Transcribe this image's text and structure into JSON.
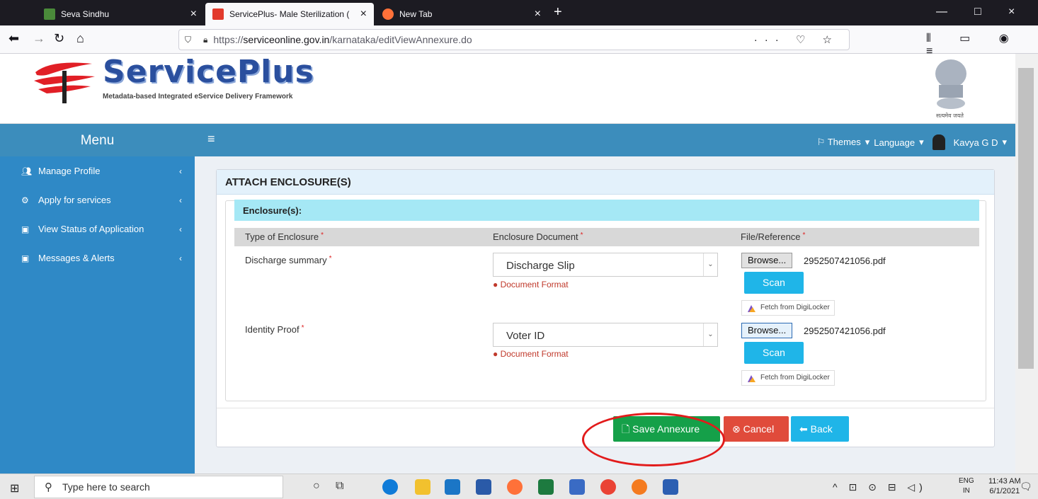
{
  "browser": {
    "tabs": [
      {
        "title": "Seva Sindhu",
        "close": "×"
      },
      {
        "title": "ServicePlus- Male Sterilization (",
        "close": "×"
      },
      {
        "title": "New Tab",
        "close": "×"
      }
    ],
    "new_tab": "+",
    "window_controls": [
      "—",
      "□",
      "×"
    ],
    "url_prefix": "https://",
    "url_host": "serviceonline.gov.in",
    "url_path": "/karnataka/editViewAnnexure.do",
    "url_icons": "··· ♡ ☆",
    "toolbar_icons": "⫴ ▭ ◉ ≡"
  },
  "header": {
    "brand": "ServicePlus",
    "tagline": "Metadata-based Integrated eService Delivery Framework",
    "emblem_text": "सत्यमेव जयते"
  },
  "sidebar": {
    "menu_title": "Menu",
    "items": [
      {
        "label": "Manage Profile",
        "icon": "users-icon"
      },
      {
        "label": "Apply for services",
        "icon": "gears-icon"
      },
      {
        "label": "View Status of Application",
        "icon": "window-icon"
      },
      {
        "label": "Messages & Alerts",
        "icon": "message-icon"
      }
    ],
    "chevron": "‹"
  },
  "topbar": {
    "hamburger": "≡",
    "themes": "⚐ Themes",
    "language": "Language",
    "user": "Kavya G D",
    "caret": "▾"
  },
  "panel": {
    "title": "ATTACH ENCLOSURE(S)",
    "section": "Enclosure(s):",
    "columns": [
      "Type of Enclosure",
      "Enclosure Document",
      "File/Reference"
    ],
    "required_mark": "*",
    "rows": [
      {
        "type": "Discharge summary",
        "document": "Discharge Slip",
        "format_note": "Document Format",
        "browse": "Browse...",
        "file": "2952507421056.pdf",
        "scan": "Scan",
        "digilocker": "Fetch from DigiLocker"
      },
      {
        "type": "Identity Proof",
        "document": "Voter ID",
        "format_note": "Document Format",
        "browse": "Browse...",
        "file": "2952507421056.pdf",
        "scan": "Scan",
        "digilocker": "Fetch from DigiLocker"
      }
    ],
    "buttons": {
      "save": "Save Annexure",
      "cancel": "Cancel",
      "back": "Back"
    }
  },
  "taskbar": {
    "search_placeholder": "Type here to search",
    "lang_top": "ENG",
    "lang_bottom": "IN",
    "time": "11:43 AM",
    "date": "6/1/2021",
    "tray_icons": "^ ⊡ ⊙ ⊟ ◁)"
  },
  "colors": {
    "sidebar": "#2f89c6",
    "topbar": "#3c8dbc",
    "save": "#15a049",
    "cancel": "#e04b3b",
    "back": "#1fb5e8",
    "highlight": "#e21b1b"
  }
}
